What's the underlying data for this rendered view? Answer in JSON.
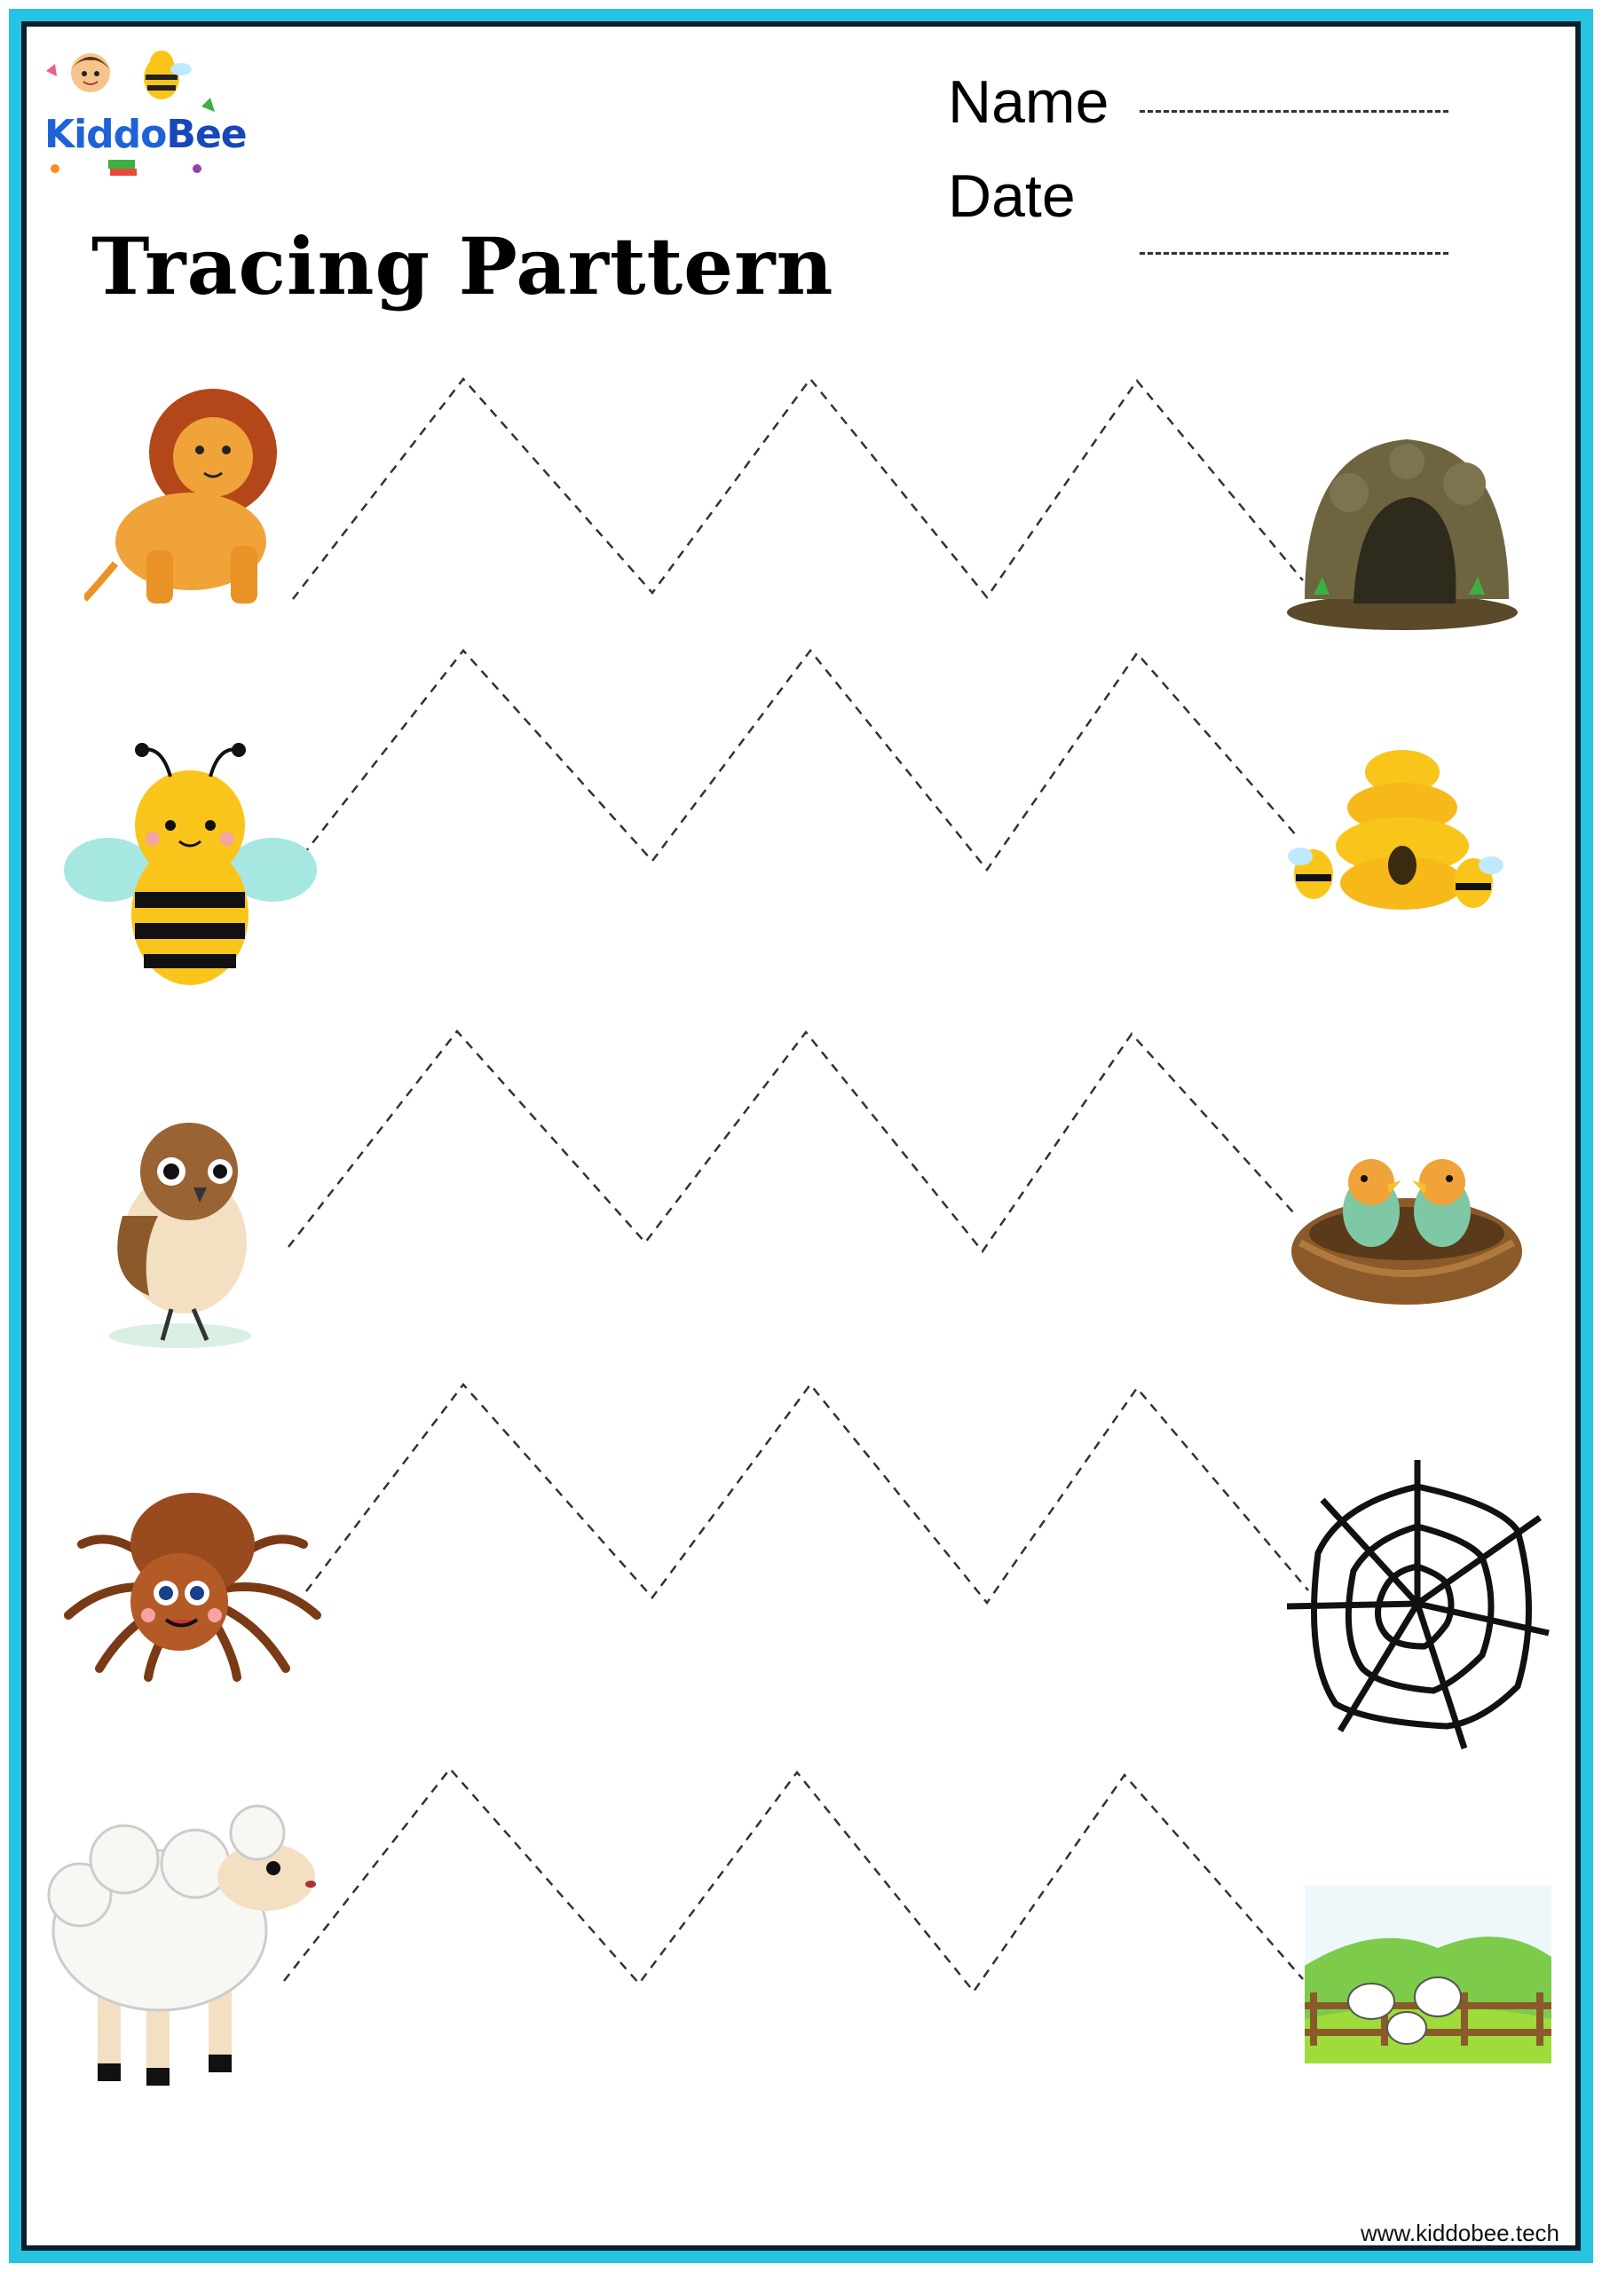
{
  "header": {
    "logo_text_1": "Kiddo",
    "logo_text_2": "Bee",
    "name_label": "Name",
    "date_label": "Date",
    "title": "Tracing Parttern"
  },
  "rows": [
    {
      "left": "lion-illustration",
      "right": "cave-illustration"
    },
    {
      "left": "bee-illustration",
      "right": "beehive-illustration"
    },
    {
      "left": "sparrow-illustration",
      "right": "nest-illustration"
    },
    {
      "left": "spider-illustration",
      "right": "spider-web-illustration"
    },
    {
      "left": "sheep-illustration",
      "right": "farm-illustration"
    }
  ],
  "footer": {
    "website": "www.kiddobee.tech"
  },
  "colors": {
    "border_outer": "#27c3e3",
    "border_inner": "#0a1f2e",
    "trace_line": "#333333"
  }
}
